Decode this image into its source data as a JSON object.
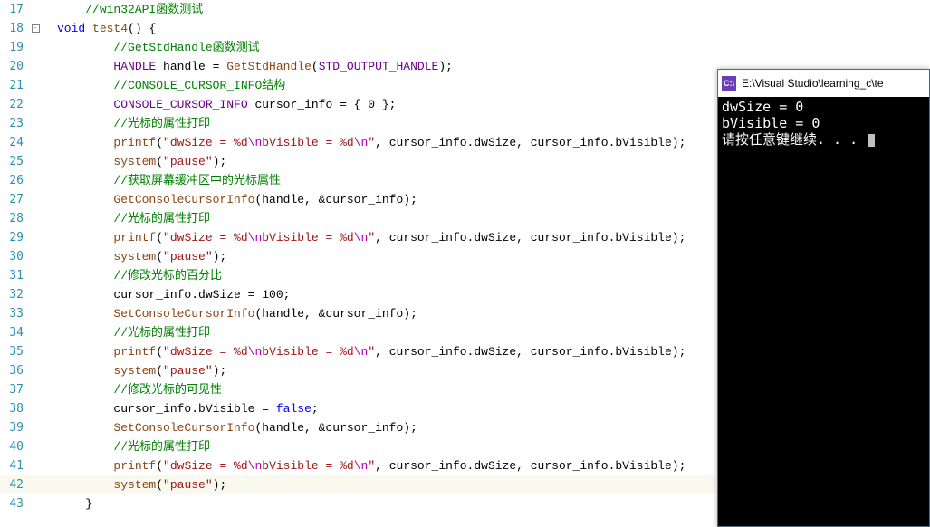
{
  "lines": [
    {
      "n": "17",
      "fold": "",
      "code": [
        [
          "ind",
          "    "
        ],
        [
          "comment",
          "//win32API函数测试"
        ]
      ]
    },
    {
      "n": "18",
      "fold": "box",
      "code": [
        [
          "kw",
          "void"
        ],
        [
          "black",
          " "
        ],
        [
          "brown",
          "test4"
        ],
        [
          "black",
          "() {"
        ]
      ]
    },
    {
      "n": "19",
      "fold": "",
      "code": [
        [
          "ind",
          "        "
        ],
        [
          "comment",
          "//GetStdHandle函数测试"
        ]
      ]
    },
    {
      "n": "20",
      "fold": "",
      "code": [
        [
          "ind",
          "        "
        ],
        [
          "upper",
          "HANDLE"
        ],
        [
          "black",
          " handle = "
        ],
        [
          "brown",
          "GetStdHandle"
        ],
        [
          "black",
          "("
        ],
        [
          "upper",
          "STD_OUTPUT_HANDLE"
        ],
        [
          "black",
          ");"
        ]
      ]
    },
    {
      "n": "21",
      "fold": "",
      "code": [
        [
          "ind",
          "        "
        ],
        [
          "comment",
          "//CONSOLE_CURSOR_INFO结构"
        ]
      ]
    },
    {
      "n": "22",
      "fold": "",
      "code": [
        [
          "ind",
          "        "
        ],
        [
          "upper",
          "CONSOLE_CURSOR_INFO"
        ],
        [
          "black",
          " cursor_info = { 0 };"
        ]
      ]
    },
    {
      "n": "23",
      "fold": "",
      "code": [
        [
          "ind",
          "        "
        ],
        [
          "comment",
          "//光标的属性打印"
        ]
      ]
    },
    {
      "n": "24",
      "fold": "",
      "code": [
        [
          "ind",
          "        "
        ],
        [
          "brown",
          "printf"
        ],
        [
          "black",
          "("
        ],
        [
          "str",
          "\"dwSize = %d"
        ],
        [
          "esc",
          "\\n"
        ],
        [
          "str",
          "bVisible = %d"
        ],
        [
          "esc",
          "\\n"
        ],
        [
          "str",
          "\""
        ],
        [
          "black",
          ", cursor_info.dwSize, cursor_info.bVisible);"
        ]
      ]
    },
    {
      "n": "25",
      "fold": "",
      "code": [
        [
          "ind",
          "        "
        ],
        [
          "brown",
          "system"
        ],
        [
          "black",
          "("
        ],
        [
          "str",
          "\"pause\""
        ],
        [
          "black",
          ");"
        ]
      ]
    },
    {
      "n": "26",
      "fold": "",
      "code": [
        [
          "ind",
          "        "
        ],
        [
          "comment",
          "//获取屏幕缓冲区中的光标属性"
        ]
      ]
    },
    {
      "n": "27",
      "fold": "",
      "code": [
        [
          "ind",
          "        "
        ],
        [
          "brown",
          "GetConsoleCursorInfo"
        ],
        [
          "black",
          "(handle, &cursor_info);"
        ]
      ]
    },
    {
      "n": "28",
      "fold": "",
      "code": [
        [
          "ind",
          "        "
        ],
        [
          "comment",
          "//光标的属性打印"
        ]
      ]
    },
    {
      "n": "29",
      "fold": "",
      "code": [
        [
          "ind",
          "        "
        ],
        [
          "brown",
          "printf"
        ],
        [
          "black",
          "("
        ],
        [
          "str",
          "\"dwSize = %d"
        ],
        [
          "esc",
          "\\n"
        ],
        [
          "str",
          "bVisible = %d"
        ],
        [
          "esc",
          "\\n"
        ],
        [
          "str",
          "\""
        ],
        [
          "black",
          ", cursor_info.dwSize, cursor_info.bVisible);"
        ]
      ]
    },
    {
      "n": "30",
      "fold": "",
      "code": [
        [
          "ind",
          "        "
        ],
        [
          "brown",
          "system"
        ],
        [
          "black",
          "("
        ],
        [
          "str",
          "\"pause\""
        ],
        [
          "black",
          ");"
        ]
      ]
    },
    {
      "n": "31",
      "fold": "",
      "code": [
        [
          "ind",
          "        "
        ],
        [
          "comment",
          "//修改光标的百分比"
        ]
      ]
    },
    {
      "n": "32",
      "fold": "",
      "code": [
        [
          "ind",
          "        "
        ],
        [
          "black",
          "cursor_info.dwSize = 100;"
        ]
      ]
    },
    {
      "n": "33",
      "fold": "",
      "code": [
        [
          "ind",
          "        "
        ],
        [
          "brown",
          "SetConsoleCursorInfo"
        ],
        [
          "black",
          "(handle, &cursor_info);"
        ]
      ]
    },
    {
      "n": "34",
      "fold": "",
      "code": [
        [
          "ind",
          "        "
        ],
        [
          "comment",
          "//光标的属性打印"
        ]
      ]
    },
    {
      "n": "35",
      "fold": "",
      "code": [
        [
          "ind",
          "        "
        ],
        [
          "brown",
          "printf"
        ],
        [
          "black",
          "("
        ],
        [
          "str",
          "\"dwSize = %d"
        ],
        [
          "esc",
          "\\n"
        ],
        [
          "str",
          "bVisible = %d"
        ],
        [
          "esc",
          "\\n"
        ],
        [
          "str",
          "\""
        ],
        [
          "black",
          ", cursor_info.dwSize, cursor_info.bVisible);"
        ]
      ]
    },
    {
      "n": "36",
      "fold": "",
      "code": [
        [
          "ind",
          "        "
        ],
        [
          "brown",
          "system"
        ],
        [
          "black",
          "("
        ],
        [
          "str",
          "\"pause\""
        ],
        [
          "black",
          ");"
        ]
      ]
    },
    {
      "n": "37",
      "fold": "",
      "code": [
        [
          "ind",
          "        "
        ],
        [
          "comment",
          "//修改光标的可见性"
        ]
      ]
    },
    {
      "n": "38",
      "fold": "",
      "code": [
        [
          "ind",
          "        "
        ],
        [
          "black",
          "cursor_info.bVisible = "
        ],
        [
          "kw",
          "false"
        ],
        [
          "black",
          ";"
        ]
      ]
    },
    {
      "n": "39",
      "fold": "",
      "code": [
        [
          "ind",
          "        "
        ],
        [
          "brown",
          "SetConsoleCursorInfo"
        ],
        [
          "black",
          "(handle, &cursor_info);"
        ]
      ]
    },
    {
      "n": "40",
      "fold": "",
      "code": [
        [
          "ind",
          "        "
        ],
        [
          "comment",
          "//光标的属性打印"
        ]
      ]
    },
    {
      "n": "41",
      "fold": "",
      "code": [
        [
          "ind",
          "        "
        ],
        [
          "brown",
          "printf"
        ],
        [
          "black",
          "("
        ],
        [
          "str",
          "\"dwSize = %d"
        ],
        [
          "esc",
          "\\n"
        ],
        [
          "str",
          "bVisible = %d"
        ],
        [
          "esc",
          "\\n"
        ],
        [
          "str",
          "\""
        ],
        [
          "black",
          ", cursor_info.dwSize, cursor_info.bVisible);"
        ]
      ]
    },
    {
      "n": "42",
      "fold": "",
      "current": true,
      "code": [
        [
          "ind",
          "        "
        ],
        [
          "brown",
          "system"
        ],
        [
          "black",
          "("
        ],
        [
          "str",
          "\"pause\""
        ],
        [
          "black",
          ");"
        ]
      ]
    },
    {
      "n": "43",
      "fold": "",
      "code": [
        [
          "ind",
          "    "
        ],
        [
          "black",
          "}"
        ]
      ]
    }
  ],
  "console": {
    "icon_text": "C:\\",
    "title": "E:\\Visual Studio\\learning_c\\te",
    "out1": "dwSize = 0",
    "out2": "bVisible = 0",
    "out3": "请按任意键继续. . . "
  }
}
